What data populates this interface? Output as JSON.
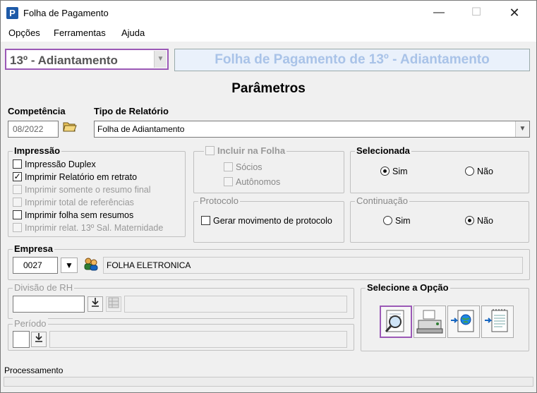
{
  "window": {
    "title": "Folha de Pagamento",
    "controls": {
      "minimize": "—",
      "maximize": "☐",
      "close": "✕"
    }
  },
  "menu": [
    "Opções",
    "Ferramentas",
    "Ajuda"
  ],
  "header": {
    "type_selected": "13º - Adiantamento",
    "banner": "Folha de Pagamento de 13º - Adiantamento"
  },
  "params_title": "Parâmetros",
  "competencia": {
    "label": "Competência",
    "value": "08/2022"
  },
  "tipo_relatorio": {
    "label": "Tipo de Relatório",
    "value": "Folha de Adiantamento"
  },
  "impressao": {
    "title": "Impressão",
    "items": [
      {
        "label": "Impressão Duplex",
        "checked": false,
        "enabled": true
      },
      {
        "label": "Imprimir Relatório em retrato",
        "checked": true,
        "enabled": true
      },
      {
        "label": "Imprimir somente o resumo final",
        "checked": false,
        "enabled": false
      },
      {
        "label": "Imprimir total de referências",
        "checked": false,
        "enabled": false
      },
      {
        "label": "Imprimir folha sem resumos",
        "checked": false,
        "enabled": true
      },
      {
        "label": "Imprimir relat. 13º Sal. Maternidade",
        "checked": false,
        "enabled": false
      }
    ]
  },
  "incluir": {
    "title": "Incluir na Folha",
    "socios": "Sócios",
    "autonomos": "Autônomos"
  },
  "protocolo": {
    "title": "Protocolo",
    "gerar": "Gerar movimento de protocolo"
  },
  "selecionada": {
    "title": "Selecionada",
    "sim": "Sim",
    "nao": "Não"
  },
  "continuacao": {
    "title": "Continuação",
    "sim": "Sim",
    "nao": "Não"
  },
  "empresa": {
    "title": "Empresa",
    "code": "0027",
    "name": "FOLHA ELETRONICA"
  },
  "divisao": {
    "title": "Divisão de RH"
  },
  "periodo": {
    "title": "Período"
  },
  "opcao": {
    "title": "Selecione a Opção"
  },
  "status": {
    "label": "Processamento"
  },
  "colors": {
    "accent": "#9b59b6",
    "banner_text": "#a9c3e8"
  }
}
